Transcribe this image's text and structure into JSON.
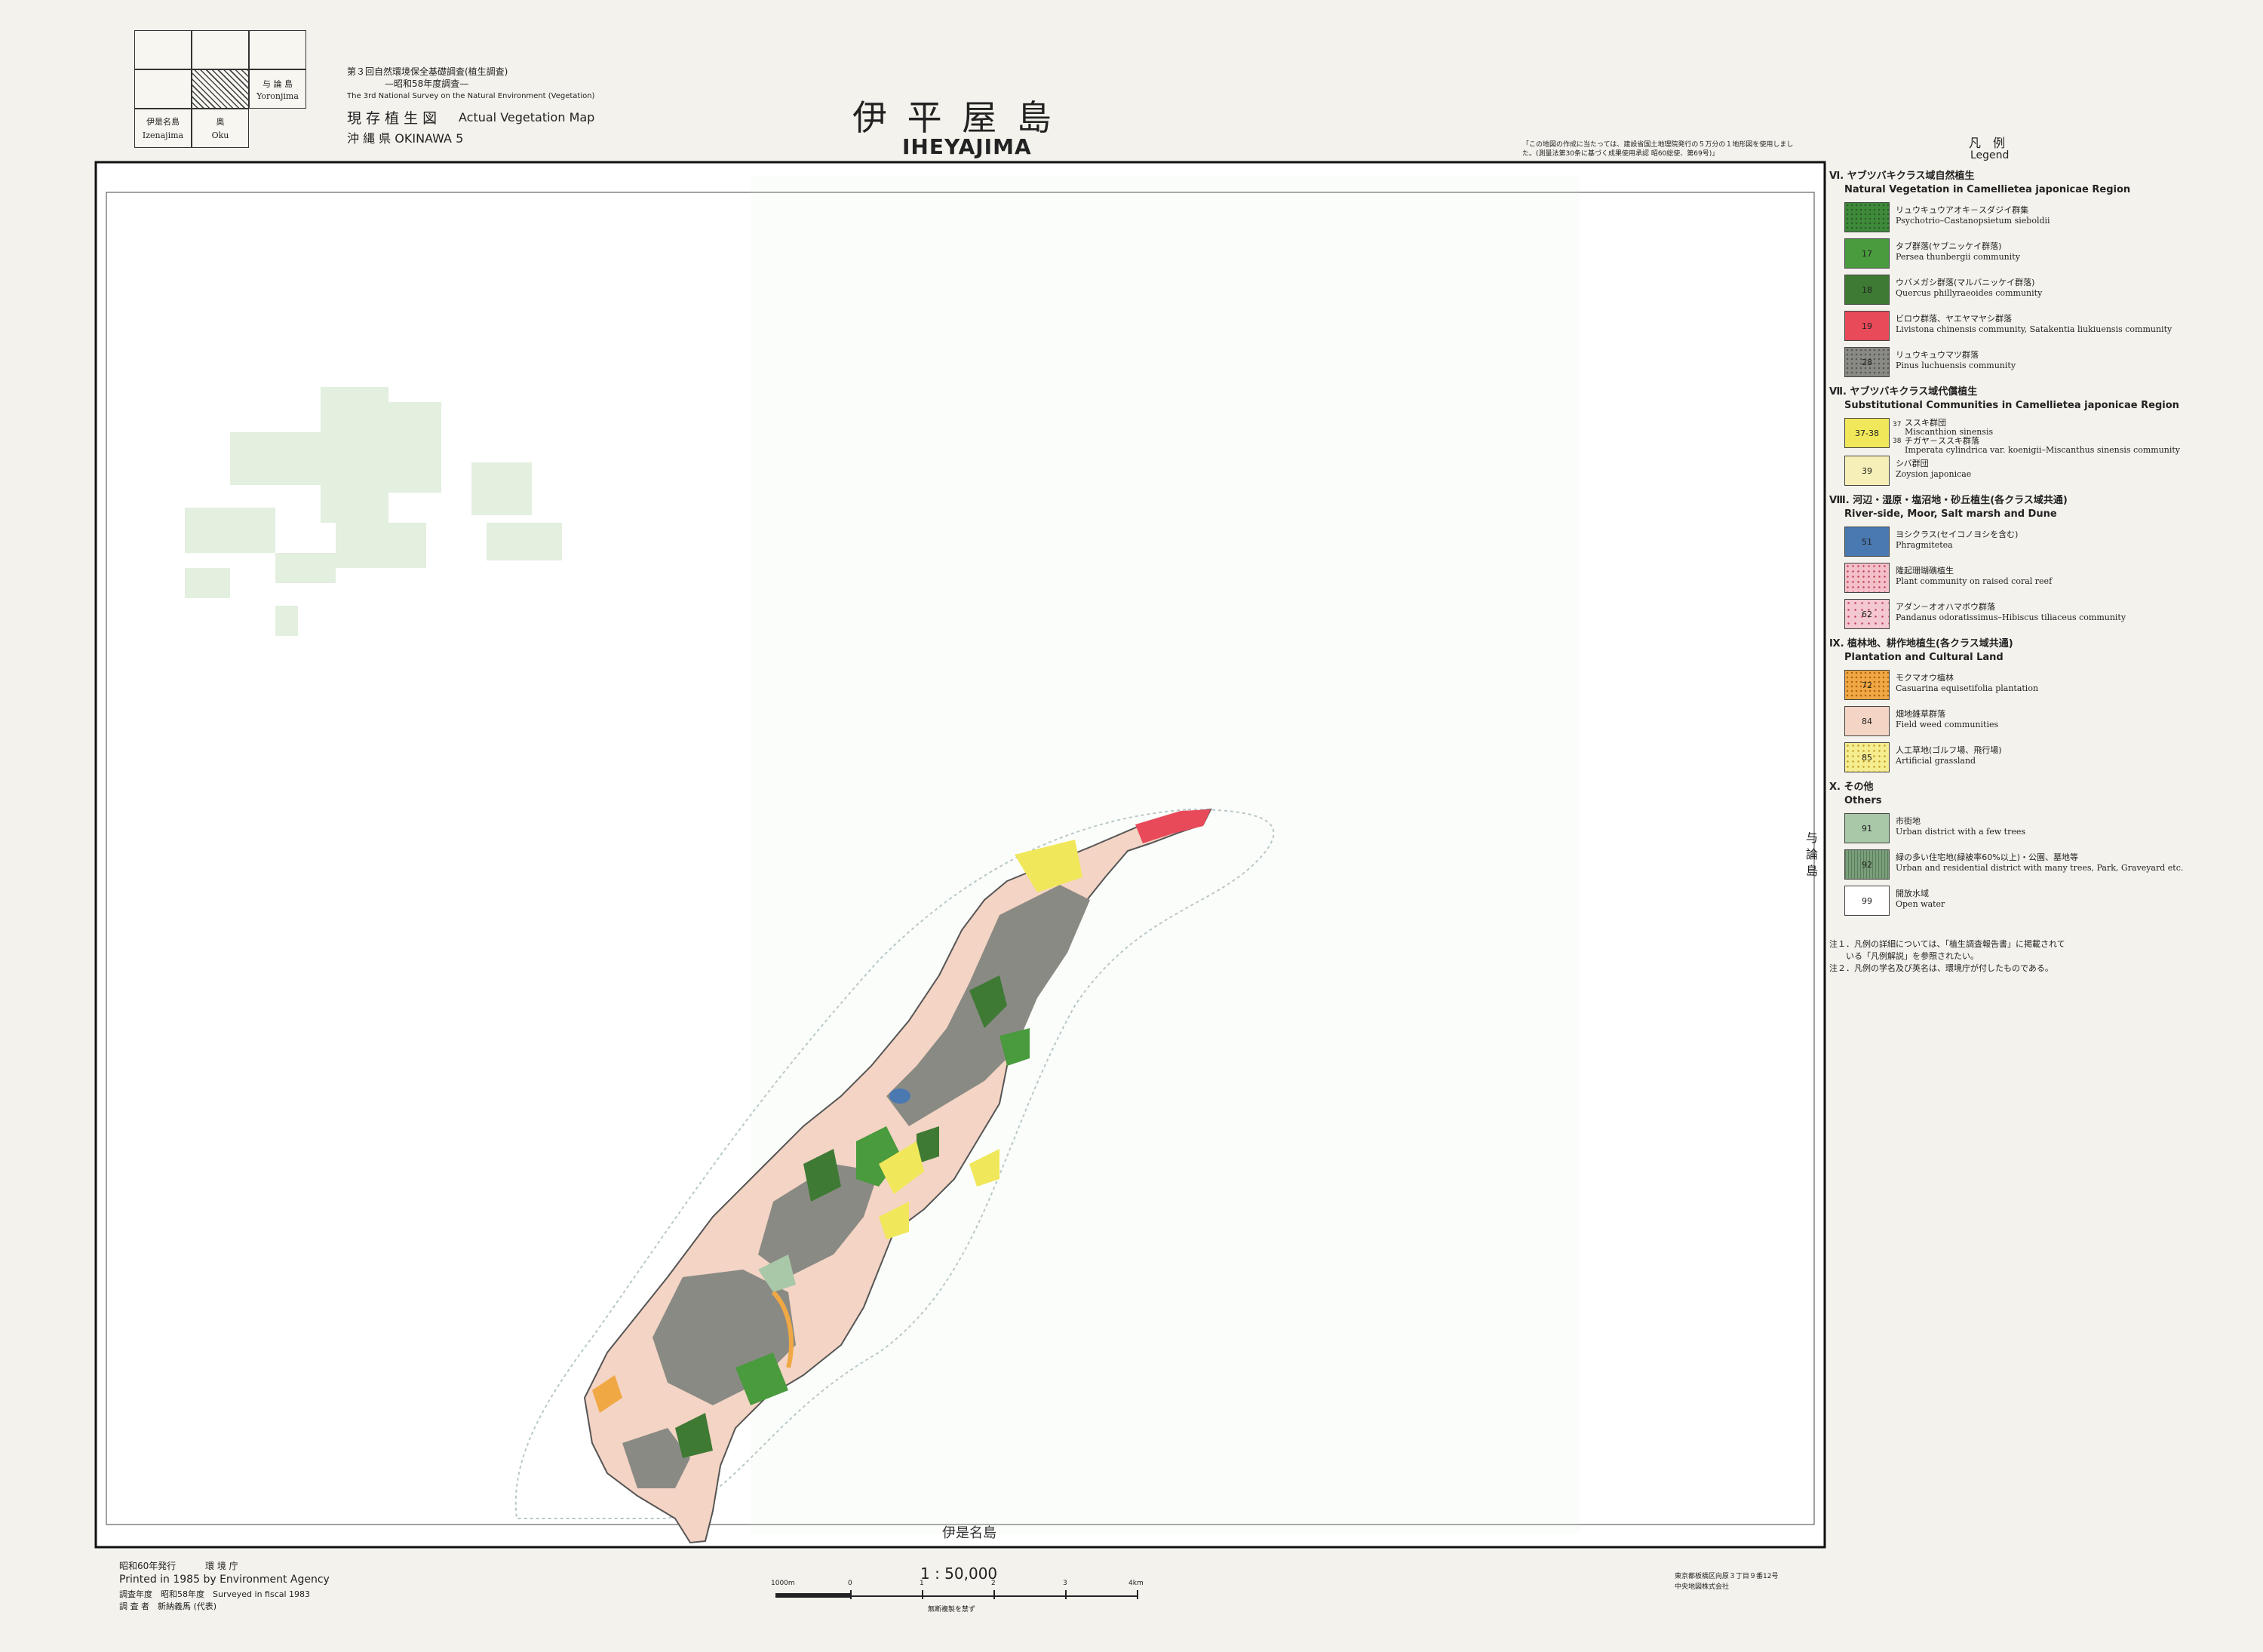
{
  "index_map": {
    "yoronjima_ja": "与 論 島",
    "yoronjima_en": "Yoronjima",
    "izenajima_ja": "伊是名島",
    "izenajima_en": "Izenajima",
    "oku_ja": "奥",
    "oku_en": "Oku"
  },
  "header": {
    "survey_ja": "第３回自然環境保全基礎調査(植生調査)",
    "survey_year_ja": "—昭和58年度調査—",
    "survey_en": "The 3rd National Survey on the Natural Environment (Vegetation)",
    "map_type_ja": "現 存 植 生 図",
    "map_type_en": "Actual Vegetation Map",
    "prefecture": "沖 縄 県 OKINAWA 5"
  },
  "title": {
    "ja": "伊 平 屋 島",
    "en": "IHEYAJIMA"
  },
  "note_top": "「この地図の作成に当たっては、建設省国土地理院発行の５万分の１地形図を使用しました。(測量法第30条に基づく成果使用承認 昭60総使、第69号)」",
  "legend": {
    "title_ja": "凡　例",
    "title_en": "Legend",
    "sections": [
      {
        "heading_ja": "Ⅵ. ヤブツバキクラス域自然植生",
        "heading_en": "Natural Vegetation in Camellietea japonicae Region"
      },
      {
        "heading_ja": "Ⅶ. ヤブツバキクラス域代償植生",
        "heading_en": "Substitutional Communities in Camellietea japonicae Region"
      },
      {
        "heading_ja": "Ⅷ. 河辺・湿原・塩沼地・砂丘植生(各クラス域共通)",
        "heading_en": "River-side, Moor, Salt marsh and Dune"
      },
      {
        "heading_ja": "Ⅸ. 植林地、耕作地植生(各クラス域共通)",
        "heading_en": "Plantation and Cultural Land"
      },
      {
        "heading_ja": "Ⅹ. その他",
        "heading_en": "Others"
      }
    ],
    "items": [
      {
        "code": "",
        "ja": "リュウキュウアオキ－スダジイ群集",
        "en": "Psychotrio–Castanopsietum sieboldii",
        "color": "#3e8a3a"
      },
      {
        "code": "17",
        "ja": "タブ群落(ヤブニッケイ群落)",
        "en": "Persea thunbergii community",
        "color": "#4a9a3e"
      },
      {
        "code": "18",
        "ja": "ウバメガシ群落(マルバニッケイ群落)",
        "en": "Quercus phillyraeoides community",
        "color": "#3f7a34"
      },
      {
        "code": "19",
        "ja": "ビロウ群落、ヤエヤマヤシ群落",
        "en": "Livistona chinensis community, Satakentia liukiuensis community",
        "color": "#e84a5a"
      },
      {
        "code": "28",
        "ja": "リュウキュウマツ群落",
        "en": "Pinus luchuensis community",
        "color": "#8a8a84"
      },
      {
        "code": "37-38",
        "ja": "ススキ群団",
        "en": "Miscanthion sinensis",
        "color": "#f0e85a"
      },
      {
        "code": "39",
        "ja": "シバ群団",
        "en": "Zoysion japonicae",
        "color": "#f6f0b8"
      },
      {
        "code": "51",
        "ja": "ヨシクラス(セイコノヨシを含む)",
        "en": "Phragmitetea",
        "color": "#4a78b0"
      },
      {
        "code": "",
        "ja": "隆起珊瑚礁植生",
        "en": "Plant community on raised coral reef",
        "color": "#f4c0c8"
      },
      {
        "code": "62",
        "ja": "アダン－オオハマボウ群落",
        "en": "Pandanus odoratissimus–Hibiscus tiliaceus community",
        "color": "#f4c8d0"
      },
      {
        "code": "72",
        "ja": "モクマオウ植林",
        "en": "Casuarina equisetifolia plantation",
        "color": "#f0a844"
      },
      {
        "code": "84",
        "ja": "畑地雑草群落",
        "en": "Field weed communities",
        "color": "#f4d4c4"
      },
      {
        "code": "85",
        "ja": "人工草地(ゴルフ場、飛行場)",
        "en": "Artificial grassland",
        "color": "#f6ec90"
      },
      {
        "code": "91",
        "ja": "市街地",
        "en": "Urban district with a few trees",
        "color": "#a8c8a8"
      },
      {
        "code": "92",
        "ja": "緑の多い住宅地(緑被率60%以上)・公園、墓地等",
        "en": "Urban and residential district with many trees, Park, Graveyard etc.",
        "color": "#7a9e7a"
      },
      {
        "code": "99",
        "ja": "開放水域",
        "en": "Open water",
        "color": "#ffffff"
      }
    ],
    "extra_37": "37",
    "extra_38": "38",
    "extra_38_ja": "チガヤ－ススキ群落",
    "extra_38_en": "Imperata cylindrica var. koenigii–Miscanthus sinensis community",
    "notes": [
      "注１．凡例の詳細については、「植生調査報告書」に掲載されて",
      "　　いる「凡例解説」を参照されたい。",
      "注２．凡例の学名及び英名は、環境庁が付したものである。"
    ]
  },
  "map_labels": {
    "bottom_neighbor": "伊是名島",
    "right_neighbor": "与論島"
  },
  "footer": {
    "published_ja": "昭和60年発行",
    "agency_ja": "環 境 庁",
    "printed_en": "Printed in 1985 by Environment Agency",
    "survey_year": "調査年度　昭和58年度　Surveyed in fiscal 1983",
    "surveyor": "調 査 者　新納義馬 (代表)",
    "scale": "1 : 50,000",
    "scale_note": "無断複製を禁ず",
    "scale_labels": [
      "1000m",
      "0",
      "1",
      "2",
      "3",
      "4km"
    ],
    "printer_address": "東京都板橋区向原３丁目９番12号",
    "printer_name": "中央地図株式会社"
  },
  "colors": {
    "paper": "#f4f2ec",
    "map_bg": "#ffffff",
    "shallow_line": "#b8c8c8",
    "ghost_green": "#dcebd8"
  }
}
